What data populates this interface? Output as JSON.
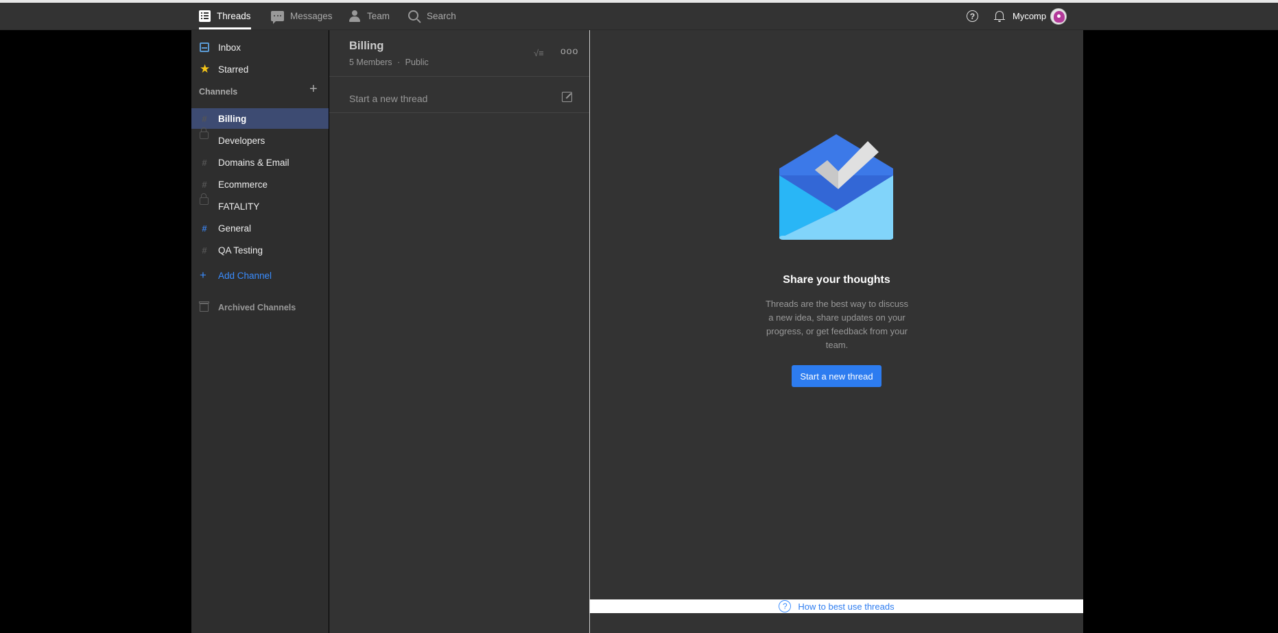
{
  "topbar": {
    "nav": [
      {
        "label": "Threads",
        "icon": "list-icon",
        "active": true
      },
      {
        "label": "Messages",
        "icon": "chat-icon",
        "active": false
      },
      {
        "label": "Team",
        "icon": "person-icon",
        "active": false
      },
      {
        "label": "Search",
        "icon": "search-icon",
        "active": false
      }
    ],
    "help_glyph": "?",
    "username": "Mycomp"
  },
  "sidebar": {
    "inbox": "Inbox",
    "starred": "Starred",
    "channels_heading": "Channels",
    "add_glyph": "+",
    "channels": [
      {
        "label": "Billing",
        "icon": "hash-icon",
        "selected": true
      },
      {
        "label": "Developers",
        "icon": "lock-icon"
      },
      {
        "label": "Domains & Email",
        "icon": "hash-icon"
      },
      {
        "label": "Ecommerce",
        "icon": "hash-icon"
      },
      {
        "label": "FATALITY",
        "icon": "lock-icon"
      },
      {
        "label": "General",
        "icon": "hash-icon",
        "accent": "#3a7de0"
      },
      {
        "label": "QA Testing",
        "icon": "hash-icon"
      }
    ],
    "add_channel": "Add Channel",
    "archived": "Archived Channels"
  },
  "threadlist": {
    "title": "Billing",
    "members": "5 Members",
    "separator": "·",
    "visibility": "Public",
    "sort_glyph": "√≡",
    "more_glyph": "ooo",
    "new_thread": "Start a new thread"
  },
  "main": {
    "empty_title": "Share your thoughts",
    "empty_desc": "Threads are the best way to discuss a new idea, share updates on your progress, or get feedback from your team.",
    "cta": "Start a new thread",
    "help_glyph": "?",
    "help_link": "How to best use threads"
  },
  "colors": {
    "accent": "#2d7cf0",
    "selected_bg": "#3d4b72",
    "star": "#f5c518"
  }
}
